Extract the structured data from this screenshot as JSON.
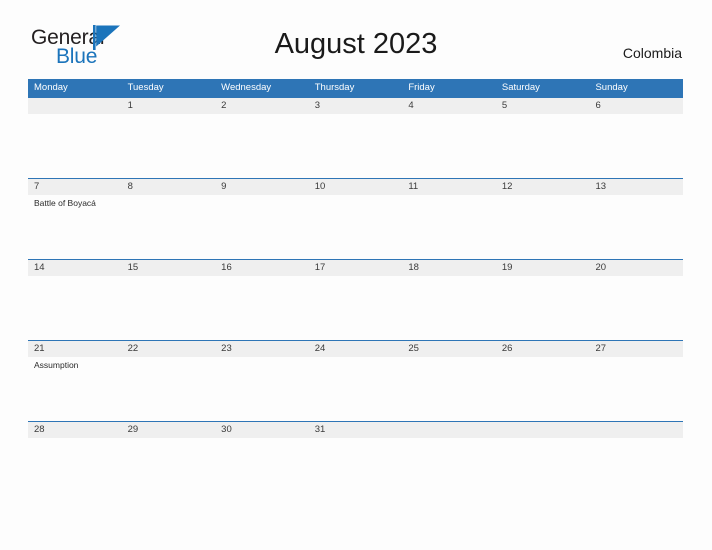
{
  "brand": {
    "name_part1": "General",
    "name_part2": "Blue",
    "flag_icon": "triangle-flag-icon",
    "accent_color": "#1b74bb"
  },
  "header": {
    "title": "August 2023",
    "country": "Colombia"
  },
  "calendar": {
    "header_bg": "#2e75b6",
    "band_bg": "#efefef",
    "weekdays": [
      "Monday",
      "Tuesday",
      "Wednesday",
      "Thursday",
      "Friday",
      "Saturday",
      "Sunday"
    ],
    "weeks": [
      {
        "days": [
          {
            "number": "",
            "event": ""
          },
          {
            "number": "1",
            "event": ""
          },
          {
            "number": "2",
            "event": ""
          },
          {
            "number": "3",
            "event": ""
          },
          {
            "number": "4",
            "event": ""
          },
          {
            "number": "5",
            "event": ""
          },
          {
            "number": "6",
            "event": ""
          }
        ]
      },
      {
        "days": [
          {
            "number": "7",
            "event": "Battle of Boyacá"
          },
          {
            "number": "8",
            "event": ""
          },
          {
            "number": "9",
            "event": ""
          },
          {
            "number": "10",
            "event": ""
          },
          {
            "number": "11",
            "event": ""
          },
          {
            "number": "12",
            "event": ""
          },
          {
            "number": "13",
            "event": ""
          }
        ]
      },
      {
        "days": [
          {
            "number": "14",
            "event": ""
          },
          {
            "number": "15",
            "event": ""
          },
          {
            "number": "16",
            "event": ""
          },
          {
            "number": "17",
            "event": ""
          },
          {
            "number": "18",
            "event": ""
          },
          {
            "number": "19",
            "event": ""
          },
          {
            "number": "20",
            "event": ""
          }
        ]
      },
      {
        "days": [
          {
            "number": "21",
            "event": "Assumption"
          },
          {
            "number": "22",
            "event": ""
          },
          {
            "number": "23",
            "event": ""
          },
          {
            "number": "24",
            "event": ""
          },
          {
            "number": "25",
            "event": ""
          },
          {
            "number": "26",
            "event": ""
          },
          {
            "number": "27",
            "event": ""
          }
        ]
      },
      {
        "days": [
          {
            "number": "28",
            "event": ""
          },
          {
            "number": "29",
            "event": ""
          },
          {
            "number": "30",
            "event": ""
          },
          {
            "number": "31",
            "event": ""
          },
          {
            "number": "",
            "event": ""
          },
          {
            "number": "",
            "event": ""
          },
          {
            "number": "",
            "event": ""
          }
        ]
      }
    ]
  }
}
